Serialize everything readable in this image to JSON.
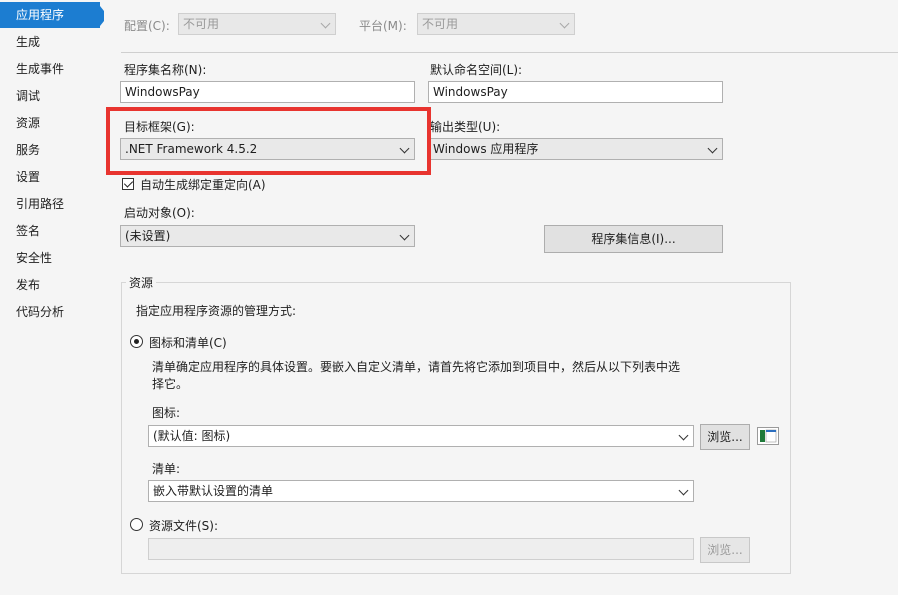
{
  "sidebar": {
    "items": [
      {
        "label": "应用程序",
        "active": true
      },
      {
        "label": "生成"
      },
      {
        "label": "生成事件"
      },
      {
        "label": "调试"
      },
      {
        "label": "资源"
      },
      {
        "label": "服务"
      },
      {
        "label": "设置"
      },
      {
        "label": "引用路径"
      },
      {
        "label": "签名"
      },
      {
        "label": "安全性"
      },
      {
        "label": "发布"
      },
      {
        "label": "代码分析"
      }
    ]
  },
  "config": {
    "config_label": "配置(C):",
    "config_value": "不可用",
    "platform_label": "平台(M):",
    "platform_value": "不可用"
  },
  "assembly": {
    "name_label": "程序集名称(N):",
    "name_value": "WindowsPay",
    "namespace_label": "默认命名空间(L):",
    "namespace_value": "WindowsPay"
  },
  "target": {
    "framework_label": "目标框架(G):",
    "framework_value": ".NET Framework 4.5.2",
    "output_label": "输出类型(U):",
    "output_value": "Windows 应用程序"
  },
  "auto_binding": {
    "label": "自动生成绑定重定向(A)",
    "checked": true
  },
  "startup": {
    "label": "启动对象(O):",
    "value": "(未设置)",
    "assembly_info_button": "程序集信息(I)..."
  },
  "resources": {
    "group_title": "资源",
    "description": "指定应用程序资源的管理方式:",
    "icon_manifest_label": "图标和清单(C)",
    "icon_manifest_help_line1": "清单确定应用程序的具体设置。要嵌入自定义清单，请首先将它添加到项目中，然后从以下列表中选",
    "icon_manifest_help_line2": "择它。",
    "icon_label": "图标:",
    "icon_value": "(默认值: 图标)",
    "browse_label": "浏览...",
    "manifest_label": "清单:",
    "manifest_value": "嵌入带默认设置的清单",
    "resource_file_label": "资源文件(S):",
    "resource_file_value": "",
    "resource_browse_label": "浏览..."
  },
  "colors": {
    "accent": "#1c7dd1",
    "highlight": "#e8342f"
  }
}
